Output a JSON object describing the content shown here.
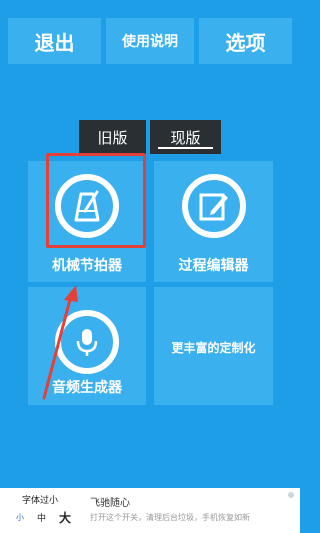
{
  "topbar": {
    "exit": "退出",
    "help": "使用说明",
    "options": "选项"
  },
  "tabs": {
    "old": "旧版",
    "new": "现版"
  },
  "tiles": {
    "metronome": {
      "label": "机械节拍器",
      "icon": "metronome-icon"
    },
    "process": {
      "label": "过程编辑器",
      "icon": "edit-icon"
    },
    "audio": {
      "label": "音频生成器",
      "icon": "microphone-icon"
    },
    "custom": {
      "label": "更丰富的定制化"
    }
  },
  "annotation": {
    "highlight_color": "#e4403a"
  },
  "bottom_bar": {
    "font_size_title": "字体过小",
    "small": "小",
    "medium": "中",
    "large": "大",
    "ad_title": "飞驰随心",
    "ad_desc": "打开这个开关，清理后台垃圾，手机恢复如新"
  },
  "colors": {
    "background": "#1e9ee6",
    "tile": "#3ab0ef",
    "tab": "#2a2f33"
  }
}
